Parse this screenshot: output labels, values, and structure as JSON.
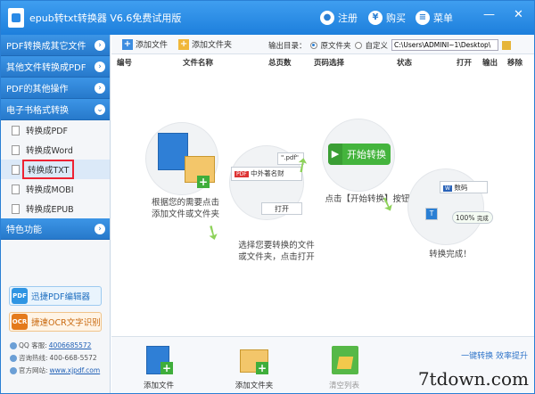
{
  "titlebar": {
    "title": "epub转txt转换器 V6.6免费试用版",
    "register": "注册",
    "buy": "购买",
    "menu": "菜单",
    "min": "—",
    "close": "✕"
  },
  "sidebar": {
    "cat_pdf_to_other": "PDF转换成其它文件",
    "cat_other_to_pdf": "其他文件转换成PDF",
    "cat_pdf_ops": "PDF的其他操作",
    "cat_ebook": "电子书格式转换",
    "items": [
      "转换成PDF",
      "转换成Word",
      "转换成TXT",
      "转换成MOBI",
      "转换成EPUB"
    ],
    "cat_special": "特色功能",
    "chevron": "›"
  },
  "promos": {
    "pdf_editor": "迅捷PDF编辑器",
    "pdf_icon": "PDF",
    "ocr": "捷速OCR文字识别",
    "ocr_icon": "OCR"
  },
  "contact": {
    "qq_label": "QQ 客服:",
    "qq_value": "4006685572",
    "phone_label": "咨询热线:",
    "phone_value": "400-668-5572",
    "site_label": "官方网站:",
    "site_value": "www.xjpdf.com"
  },
  "toolbar": {
    "add_file": "添加文件",
    "add_folder": "添加文件夹",
    "output_dir": "输出目录：",
    "orig_folder": "原文件夹",
    "custom": "自定义",
    "path": "C:\\Users\\ADMINI~1\\Desktop\\"
  },
  "columns": [
    "编号",
    "文件名称",
    "总页数",
    "页码选择",
    "状态",
    "打开",
    "输出",
    "移除"
  ],
  "workflow": {
    "step1": "根据您的需要点击\n添加文件或文件夹",
    "step2": "选择您要转换的文件\n或文件夹，点击打开",
    "step3": "点击【开始转换】按钮",
    "step4": "转换完成！",
    "start_button": "开始转换",
    "pdf_file": "中外著名财",
    "pdf_ext": "\".pdf\"",
    "open": "打开",
    "numbers_label": "数码",
    "percent": "100%",
    "done": "完成"
  },
  "bottom": {
    "add_file": "添加文件",
    "add_folder": "添加文件夹",
    "clear_list": "清空列表",
    "one_key": "一键转换  效率提升"
  },
  "watermark": "7tdown.com",
  "colors": {
    "title_blue": "#2a86e0",
    "accent_green": "#44b43d",
    "highlight_red": "#e23333"
  }
}
